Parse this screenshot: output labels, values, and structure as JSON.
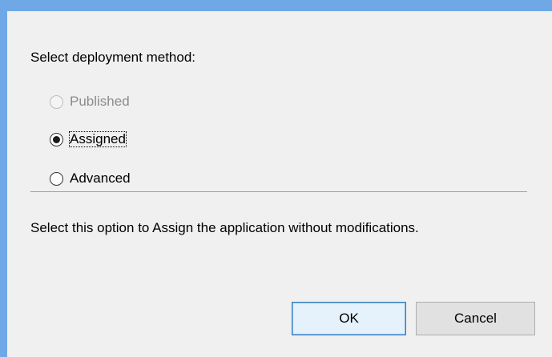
{
  "dialog": {
    "prompt": "Select deployment method:",
    "options": [
      {
        "label": "Published",
        "selected": false,
        "enabled": false
      },
      {
        "label": "Assigned",
        "selected": true,
        "enabled": true
      },
      {
        "label": "Advanced",
        "selected": false,
        "enabled": true
      }
    ],
    "description": "Select this option to Assign the application without modifications.",
    "ok_label": "OK",
    "cancel_label": "Cancel"
  },
  "colors": {
    "frame": "#6fa8e6",
    "client_background": "#f0f0f0",
    "disabled_text": "#8c8c8c",
    "default_button_border": "#3c7fb1"
  }
}
